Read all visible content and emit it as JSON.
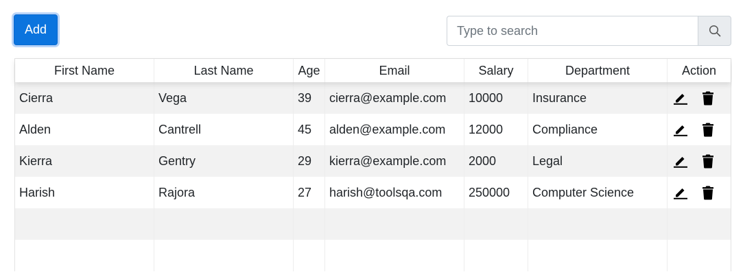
{
  "toolbar": {
    "add_label": "Add",
    "search_placeholder": "Type to search",
    "search_value": ""
  },
  "table": {
    "headers": [
      "First Name",
      "Last Name",
      "Age",
      "Email",
      "Salary",
      "Department",
      "Action"
    ],
    "rows": [
      {
        "first": "Cierra",
        "last": "Vega",
        "age": "39",
        "email": "cierra@example.com",
        "salary": "10000",
        "department": "Insurance"
      },
      {
        "first": "Alden",
        "last": "Cantrell",
        "age": "45",
        "email": "alden@example.com",
        "salary": "12000",
        "department": "Compliance"
      },
      {
        "first": "Kierra",
        "last": "Gentry",
        "age": "29",
        "email": "kierra@example.com",
        "salary": "2000",
        "department": "Legal"
      },
      {
        "first": "Harish",
        "last": "Rajora",
        "age": "27",
        "email": "harish@toolsqa.com",
        "salary": "250000",
        "department": "Computer Science"
      }
    ],
    "action_icons": [
      "edit-icon",
      "delete-icon"
    ]
  },
  "colors": {
    "primary": "#0b74de",
    "row_stripe": "#f2f2f2",
    "search_button_bg": "#e9ecef"
  }
}
